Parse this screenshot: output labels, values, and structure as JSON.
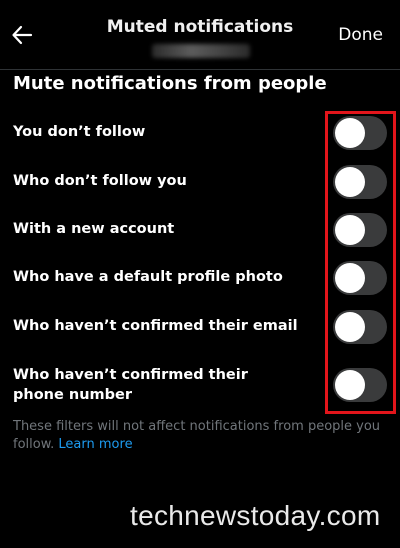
{
  "header": {
    "title": "Muted notifications",
    "done_label": "Done"
  },
  "section": {
    "title": "Mute notifications from people"
  },
  "filters": [
    {
      "label": "You don’t follow",
      "enabled": false
    },
    {
      "label": "Who don’t follow you",
      "enabled": false
    },
    {
      "label": "With a new account",
      "enabled": false
    },
    {
      "label": "Who have a default profile photo",
      "enabled": false
    },
    {
      "label": "Who haven’t confirmed their email",
      "enabled": false
    },
    {
      "label": "Who haven’t confirmed their phone number",
      "enabled": false
    }
  ],
  "footnote": {
    "text": "These filters will not affect notifications from people you follow.",
    "link": "Learn more"
  },
  "watermark": "technewstoday.com",
  "colors": {
    "background": "#000000",
    "toggle_off": "#3a3b3c",
    "link": "#1d9bf0",
    "highlight": "#e2151b"
  },
  "icons": {
    "back": "arrow-left-icon"
  }
}
